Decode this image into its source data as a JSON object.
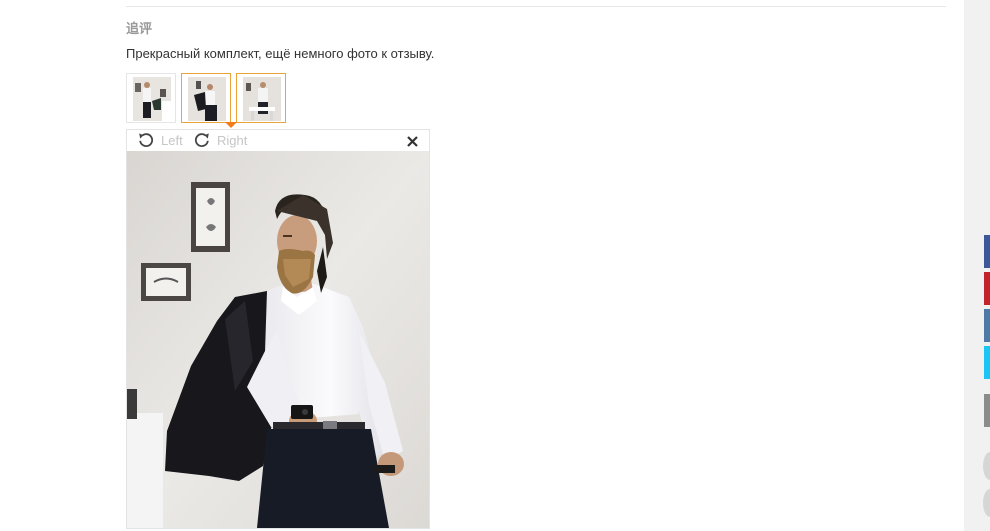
{
  "review": {
    "section_title": "追评",
    "text": "Прекрасный комплект, ещё немного фото к отзыву."
  },
  "thumbnails": [
    {
      "selected": false
    },
    {
      "selected": true
    },
    {
      "selected": true
    }
  ],
  "viewer": {
    "rotate_left_label": "Left",
    "rotate_right_label": "Right"
  },
  "share_sidebar": {
    "buttons": [
      {
        "color": "#3b5998"
      },
      {
        "color": "#c4222b"
      },
      {
        "color": "#4f7aa6"
      },
      {
        "color": "#1cc6f4"
      },
      {
        "color": "#8c8c8c"
      }
    ]
  },
  "colors": {
    "accent": "#e8a33a",
    "pointer": "#f37b1d",
    "muted_text": "#c6c6c6",
    "title_text": "#999999"
  }
}
